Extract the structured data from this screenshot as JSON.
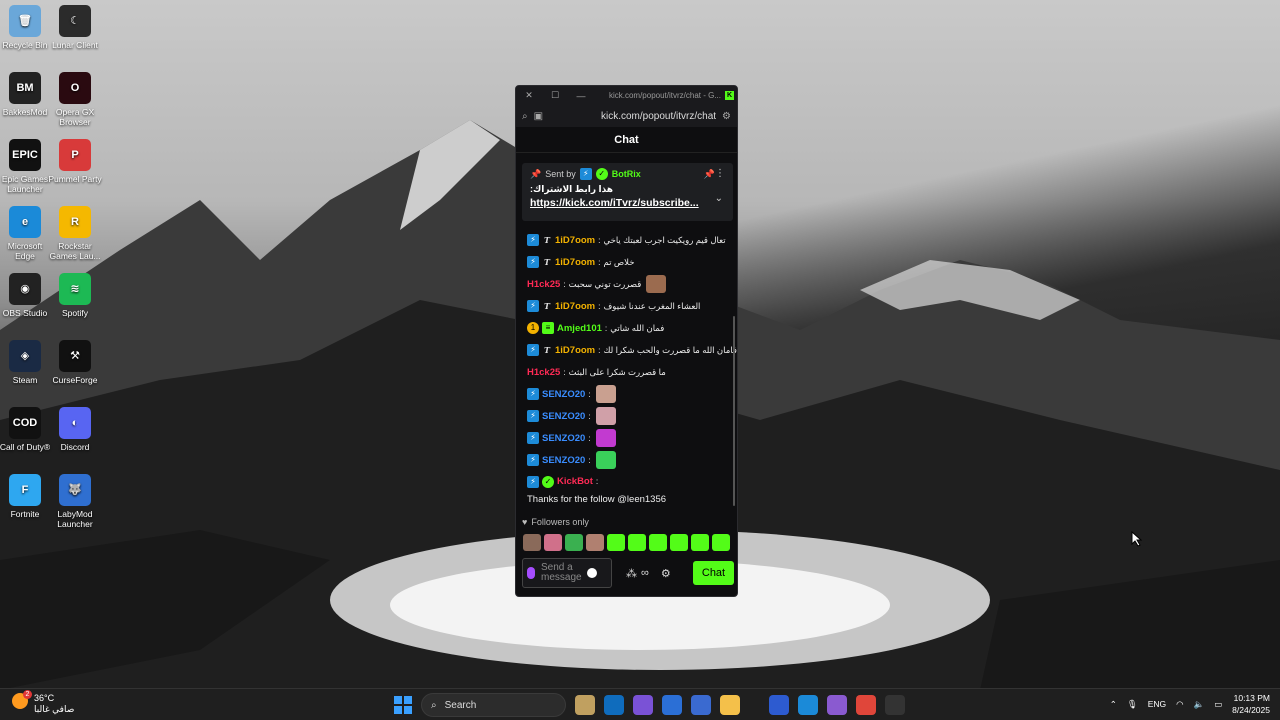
{
  "desktop": {
    "icons": [
      {
        "label": "Recycle Bin",
        "glyph": "🗑",
        "color": "#6aa7d9",
        "icon": "recycle-bin-icon"
      },
      {
        "label": "Lunar Client",
        "glyph": "☾",
        "color": "#2b2b2b",
        "icon": "lunar-client-icon"
      },
      {
        "label": "BakkesMod",
        "glyph": "BM",
        "color": "#222222",
        "icon": "bakkesmod-icon"
      },
      {
        "label": "Opera GX Browser",
        "glyph": "O",
        "color": "#2a0a10",
        "icon": "opera-gx-icon"
      },
      {
        "label": "Epic Games Launcher",
        "glyph": "EPIC",
        "color": "#111111",
        "icon": "epic-games-icon"
      },
      {
        "label": "Pummel Party",
        "glyph": "P",
        "color": "#d83a3a",
        "icon": "pummel-party-icon"
      },
      {
        "label": "Microsoft Edge",
        "glyph": "e",
        "color": "#1b8ad8",
        "icon": "edge-icon"
      },
      {
        "label": "Rockstar Games Lau...",
        "glyph": "R",
        "color": "#f5b800",
        "icon": "rockstar-icon"
      },
      {
        "label": "OBS Studio",
        "glyph": "◉",
        "color": "#222222",
        "icon": "obs-icon"
      },
      {
        "label": "Spotify",
        "glyph": "≋",
        "color": "#1db954",
        "icon": "spotify-icon"
      },
      {
        "label": "Steam",
        "glyph": "◈",
        "color": "#1a2a44",
        "icon": "steam-icon"
      },
      {
        "label": "CurseForge",
        "glyph": "⚒",
        "color": "#111111",
        "icon": "curseforge-icon"
      },
      {
        "label": "Call of Duty®",
        "glyph": "COD",
        "color": "#111111",
        "icon": "call-of-duty-icon"
      },
      {
        "label": "Discord",
        "glyph": "◐",
        "color": "#5865f2",
        "icon": "discord-icon"
      },
      {
        "label": "Fortnite",
        "glyph": "F",
        "color": "#2ea7f0",
        "icon": "fortnite-icon"
      },
      {
        "label": "LabyMod Launcher",
        "glyph": "🐺",
        "color": "#2f6fd0",
        "icon": "labymod-icon"
      }
    ]
  },
  "chat_window": {
    "window_title": "kick.com/popout/itvrz/chat - G...",
    "url": "kick.com/popout/itvrz/chat",
    "header": "Chat",
    "pinned": {
      "sent_by_label": "Sent by",
      "sender": "BotRix",
      "message": "هذا رابط الاشتراك:",
      "link": "https://kick.com/iTvrz/subscribe..."
    },
    "messages": [
      {
        "user": "1iD7oom",
        "color": "#f3b200",
        "text": "تعال قيم رويكيت اجرب لعبتك ياخي",
        "badges": [
          "blue",
          "t"
        ]
      },
      {
        "user": "1iD7oom",
        "color": "#f3b200",
        "text": "خلاص تم",
        "badges": [
          "blue",
          "t"
        ]
      },
      {
        "user": "H1ck25",
        "color": "#ff2a55",
        "text": "قصررت توني سحبت",
        "badges": [],
        "emote": "#9b6b4f"
      },
      {
        "user": "1iD7oom",
        "color": "#f3b200",
        "text": "العشاء المغرب عندنا شيوف",
        "badges": [
          "blue",
          "t"
        ]
      },
      {
        "user": "Amjed101",
        "color": "#53fc18",
        "text": "فمان الله شاتي",
        "badges": [
          "gold",
          "green"
        ]
      },
      {
        "user": "1iD7oom",
        "color": "#f3b200",
        "text": "فامان الله ما قصررت والحب شكرا لك",
        "badges": [
          "blue",
          "t"
        ]
      },
      {
        "user": "H1ck25",
        "color": "#ff2a55",
        "text": "ما قصررت شكرا على البثث",
        "badges": []
      },
      {
        "user": "SENZO20",
        "color": "#3a8dff",
        "text": "",
        "badges": [
          "blue"
        ],
        "emote": "#c9a090"
      },
      {
        "user": "SENZO20",
        "color": "#3a8dff",
        "text": "",
        "badges": [
          "blue"
        ],
        "emote": "#d0a0a8"
      },
      {
        "user": "SENZO20",
        "color": "#3a8dff",
        "text": "",
        "badges": [
          "blue"
        ],
        "emote": "#c23ad0"
      },
      {
        "user": "SENZO20",
        "color": "#3a8dff",
        "text": "",
        "badges": [
          "blue"
        ],
        "emote": "#3ad05a"
      }
    ],
    "kickbot": {
      "user": "KickBot",
      "color": "#ff2a55",
      "text": "Thanks for the follow @leen1356"
    },
    "followers_only": "Followers only",
    "emote_bar": [
      "#8a6a5a",
      "#d0708a",
      "#3ab050",
      "#b08070",
      "#53fc18",
      "#53fc18",
      "#53fc18",
      "#53fc18",
      "#53fc18",
      "#53fc18"
    ],
    "input_placeholder": "Send a message",
    "chat_button": "Chat"
  },
  "taskbar": {
    "weather_temp": "36°C",
    "weather_desc": "صافي غالبا",
    "weather_badge": "2",
    "search_placeholder": "Search",
    "apps": [
      {
        "color": "#c0a060",
        "icon": "deer-app-icon"
      },
      {
        "color": "#0f6cbd",
        "icon": "outlook-icon"
      },
      {
        "color": "#7a52d6",
        "icon": "copilot-icon"
      },
      {
        "color": "#2b6fd6",
        "icon": "store-icon"
      },
      {
        "color": "#3a6ad0",
        "icon": "shield-app-icon"
      },
      {
        "color": "#f4c04a",
        "icon": "file-explorer-icon"
      },
      {
        "color": "#2d5bd0",
        "icon": "malwarebytes-icon"
      },
      {
        "color": "#1b8ad8",
        "icon": "edge-icon"
      },
      {
        "color": "#8a5ad0",
        "icon": "discord-taskbar-icon"
      },
      {
        "color": "#e0463a",
        "icon": "chrome-icon"
      },
      {
        "color": "#333333",
        "icon": "kick-taskbar-icon"
      }
    ],
    "lang": "ENG",
    "time": "10:13 PM",
    "date": "8/24/2025"
  }
}
